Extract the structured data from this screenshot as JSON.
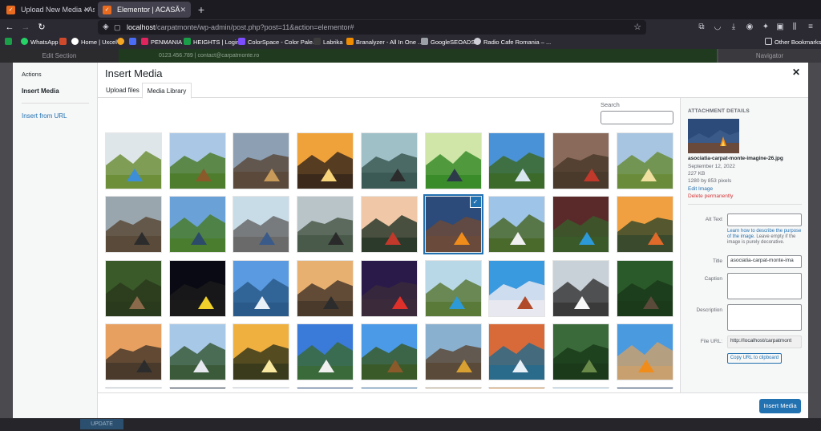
{
  "browser": {
    "tabs": [
      {
        "title": "Upload New Media ‹ Asociați",
        "active": false
      },
      {
        "title": "Elementor | ACASĂ",
        "active": true
      }
    ],
    "url_host": "localhost",
    "url_path": "/carpatmonte/wp-admin/post.php?post=11&action=elementor#",
    "bookmarks": [
      {
        "label": "WhatsApp",
        "color": "#25d366"
      },
      {
        "label": "",
        "color": "#cf4a2c"
      },
      {
        "label": "Home | Uxcel",
        "color": "#ffffff"
      },
      {
        "label": "",
        "color": "#f5a623"
      },
      {
        "label": "",
        "color": "#4a6cf7"
      },
      {
        "label": "PENMANIA",
        "color": "#e0245e"
      },
      {
        "label": "HEIGHTS | Login",
        "color": "#1a9e47"
      },
      {
        "label": "ColorSpace - Color Pale...",
        "color": "#7c4dff"
      },
      {
        "label": "Labrika",
        "color": "#3c3c3c"
      },
      {
        "label": "Branalyzer - All In One ...",
        "color": "#f08c00"
      },
      {
        "label": "GoogleSEOADS",
        "color": "#9aa0a6"
      },
      {
        "label": "Radio Cafe Romania – ...",
        "color": "#cfcfd8"
      }
    ],
    "other_bookmarks": "Other Bookmarks"
  },
  "background": {
    "panel_title": "Edit Section",
    "topbar_text": "0123.456.789 | contact@carpatmonte.ro",
    "navigator": "Navigator",
    "update_label": "UPDATE"
  },
  "modal": {
    "menu": {
      "title": "Actions",
      "items": [
        "Insert Media",
        "Insert from URL"
      ]
    },
    "title": "Insert Media",
    "tabs": [
      "Upload files",
      "Media Library"
    ],
    "search_label": "Search",
    "selected_index": 14,
    "thumbs": [
      {
        "sky": "#dfe6ea",
        "ground": "#6e8f3a",
        "accent": "#3c8ed8"
      },
      {
        "sky": "#aac8e6",
        "ground": "#4f7d2e",
        "accent": "#8a5a2b"
      },
      {
        "sky": "#8c9fb3",
        "ground": "#5b4a3c",
        "accent": "#c89a5a"
      },
      {
        "sky": "#f0a23a",
        "ground": "#3b2a1c",
        "accent": "#f7d37a"
      },
      {
        "sky": "#9fc0c7",
        "ground": "#3c5a55",
        "accent": "#2c2c2c"
      },
      {
        "sky": "#cfe6a8",
        "ground": "#3a8c2a",
        "accent": "#2c3a4a"
      },
      {
        "sky": "#4a92d8",
        "ground": "#3c6a2a",
        "accent": "#d8e6f0"
      },
      {
        "sky": "#8a6a5a",
        "ground": "#4a3a2c",
        "accent": "#c0392b"
      },
      {
        "sky": "#a7c5e0",
        "ground": "#6a8c3a",
        "accent": "#f0e0a0"
      },
      {
        "sky": "#9aa6ad",
        "ground": "#5a4a3a",
        "accent": "#2c2c2c"
      },
      {
        "sky": "#6aa2d8",
        "ground": "#4a7d2e",
        "accent": "#2c4a6a"
      },
      {
        "sky": "#c8dce8",
        "ground": "#6a6a6a",
        "accent": "#3a5a8a"
      },
      {
        "sky": "#b8c4c8",
        "ground": "#4a5a4a",
        "accent": "#2a2a2a"
      },
      {
        "sky": "#f0c8a8",
        "ground": "#2c3a2c",
        "accent": "#c0392b"
      },
      {
        "sky": "#2c4a7a",
        "ground": "#6a4a3a",
        "accent": "#f08c1a"
      },
      {
        "sky": "#9ec4e8",
        "ground": "#4a6a2c",
        "accent": "#f0f0f0"
      },
      {
        "sky": "#5a2a2a",
        "ground": "#3a5a2a",
        "accent": "#2c9ad8"
      },
      {
        "sky": "#f0a040",
        "ground": "#3a4a2c",
        "accent": "#e06a2a"
      },
      {
        "sky": "#3a5a2a",
        "ground": "#2a3a1c",
        "accent": "#8a6a4a"
      },
      {
        "sky": "#0a0a14",
        "ground": "#1a1a1a",
        "accent": "#f0d02a"
      },
      {
        "sky": "#5a9ae0",
        "ground": "#2a5a8a",
        "accent": "#e8f0f8"
      },
      {
        "sky": "#e8b070",
        "ground": "#4a3a2c",
        "accent": "#2c2c2c"
      },
      {
        "sky": "#2a1a4a",
        "ground": "#3a2a3a",
        "accent": "#e0302a"
      },
      {
        "sky": "#b8d8e8",
        "ground": "#5a7a3a",
        "accent": "#2c9ad8"
      },
      {
        "sky": "#3a9ae0",
        "ground": "#e8e8f0",
        "accent": "#b04a2a"
      },
      {
        "sky": "#c8d0d8",
        "ground": "#3a3a3a",
        "accent": "#f8f8f8"
      },
      {
        "sky": "#2a5a2a",
        "ground": "#1a3a1a",
        "accent": "#5a4a3a"
      },
      {
        "sky": "#e8a060",
        "ground": "#4a3a2c",
        "accent": "#2c2c2c"
      },
      {
        "sky": "#a8c8e8",
        "ground": "#3a5a3a",
        "accent": "#e8e8f0"
      },
      {
        "sky": "#f0b040",
        "ground": "#3a3a1c",
        "accent": "#f8e8a0"
      },
      {
        "sky": "#3a7ad8",
        "ground": "#3a6a3a",
        "accent": "#f0f0f0"
      },
      {
        "sky": "#4a9ae8",
        "ground": "#3a5a2a",
        "accent": "#8a5a2a"
      },
      {
        "sky": "#8ab0d0",
        "ground": "#5a4a3a",
        "accent": "#d8a030"
      },
      {
        "sky": "#d86a3a",
        "ground": "#2a6a8a",
        "accent": "#e8f0f8"
      },
      {
        "sky": "#3a6a3a",
        "ground": "#1a3a1a",
        "accent": "#6a8a4a"
      },
      {
        "sky": "#4a9ae0",
        "ground": "#c8a070",
        "accent": "#f08c1a"
      },
      {
        "sky": "#c8d0d8",
        "ground": "#8a8a8a",
        "accent": "#5a7a9a"
      },
      {
        "sky": "#2a3a4a",
        "ground": "#3a4a5a",
        "accent": "#8a9aaa"
      },
      {
        "sky": "#d0d8e0",
        "ground": "#a0a8b0",
        "accent": "#6a7a8a"
      },
      {
        "sky": "#3a5a8a",
        "ground": "#2a3a5a",
        "accent": "#8aaad0"
      },
      {
        "sky": "#4a7aa8",
        "ground": "#2a4a6a",
        "accent": "#c8d8e8"
      },
      {
        "sky": "#b8a890",
        "ground": "#8a7a60",
        "accent": "#5a4a3a"
      },
      {
        "sky": "#c88a4a",
        "ground": "#8a5a2a",
        "accent": "#3a2a1a"
      },
      {
        "sky": "#aac8d8",
        "ground": "#7a9aa8",
        "accent": "#3a5a6a"
      },
      {
        "sky": "#2a4a6a",
        "ground": "#1a3a5a",
        "accent": "#6a8aaa"
      }
    ],
    "details": {
      "heading": "ATTACHMENT DETAILS",
      "filename": "asociatia-carpat-monte-imagine-26.jpg",
      "date": "September 12, 2022",
      "size": "227 KB",
      "dimensions": "1280 by 853 pixels",
      "edit_link": "Edit Image",
      "delete_link": "Delete permanently",
      "alt_label": "Alt Text",
      "alt_value": "",
      "alt_help_link": "Learn how to describe the purpose of the image.",
      "alt_help_rest": " Leave empty if the image is purely decorative.",
      "title_label": "Title",
      "title_value": "asociatia-carpat-monte-ima",
      "caption_label": "Caption",
      "description_label": "Description",
      "file_url_label": "File URL:",
      "file_url_value": "http://localhost/carpatmont",
      "copy_button": "Copy URL to clipboard"
    },
    "insert_button": "Insert Media"
  }
}
